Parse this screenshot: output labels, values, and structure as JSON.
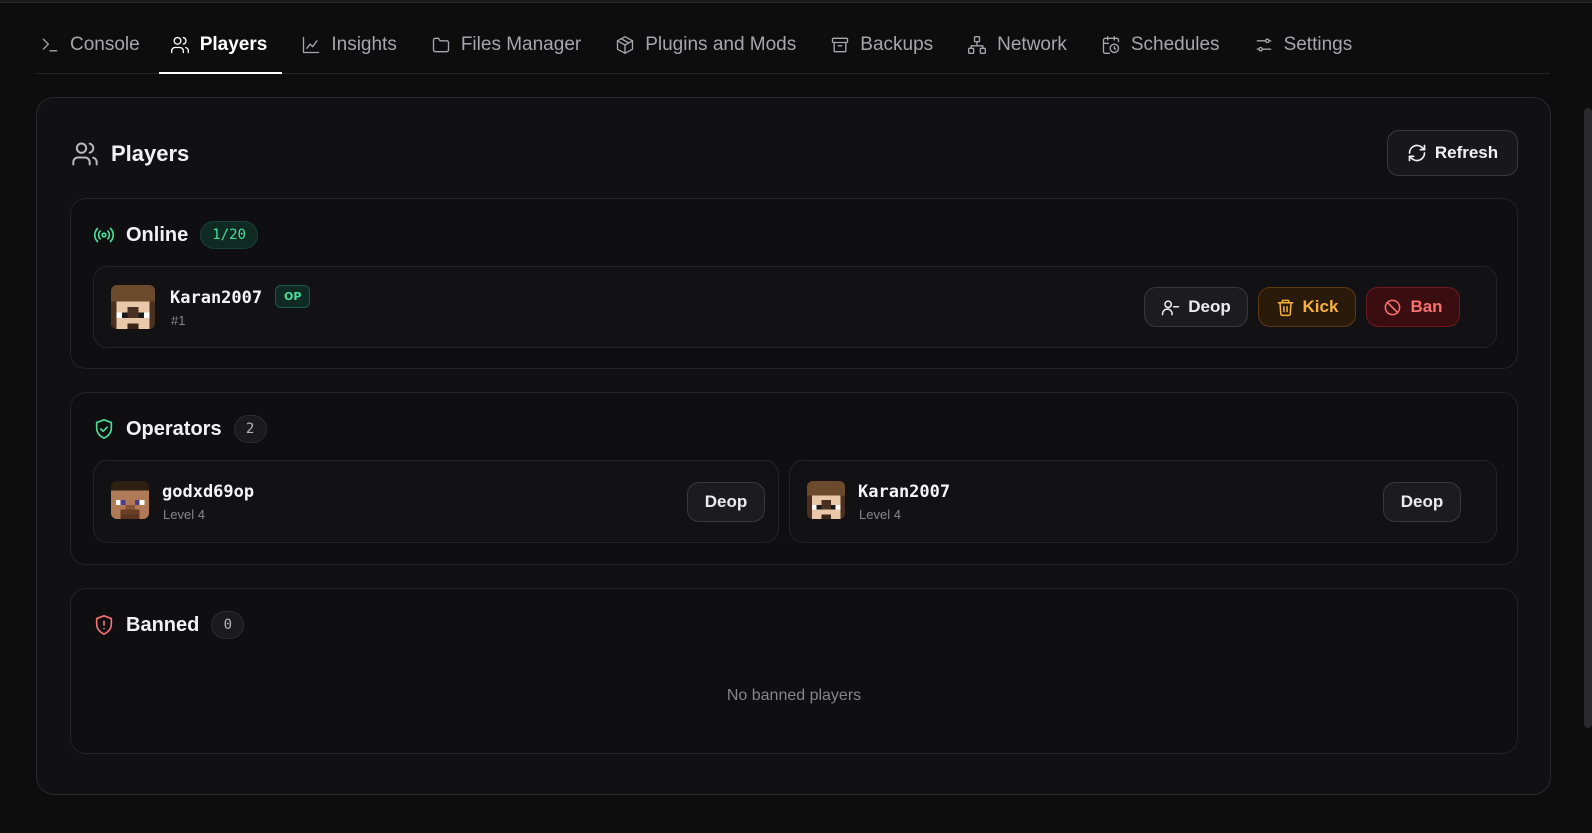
{
  "tabs": [
    {
      "label": "Console",
      "icon": "terminal-icon"
    },
    {
      "label": "Players",
      "icon": "users-icon",
      "active": true
    },
    {
      "label": "Insights",
      "icon": "chart-line-icon"
    },
    {
      "label": "Files Manager",
      "icon": "folder-icon"
    },
    {
      "label": "Plugins and Mods",
      "icon": "package-icon"
    },
    {
      "label": "Backups",
      "icon": "archive-icon"
    },
    {
      "label": "Network",
      "icon": "network-icon"
    },
    {
      "label": "Schedules",
      "icon": "calendar-clock-icon"
    },
    {
      "label": "Settings",
      "icon": "settings-sliders-icon"
    }
  ],
  "players_panel": {
    "title": "Players",
    "refresh_label": "Refresh"
  },
  "online": {
    "title": "Online",
    "count": "1/20",
    "players": [
      {
        "name": "Karan2007",
        "badge": "OP",
        "sub": "#1",
        "deop": "Deop",
        "kick": "Kick",
        "ban": "Ban"
      }
    ]
  },
  "operators": {
    "title": "Operators",
    "count": "2",
    "players": [
      {
        "name": "godxd69op",
        "sub": "Level 4",
        "deop": "Deop"
      },
      {
        "name": "Karan2007",
        "sub": "Level 4",
        "deop": "Deop"
      }
    ]
  },
  "banned": {
    "title": "Banned",
    "count": "0",
    "empty": "No banned players"
  },
  "colors": {
    "background": "#0d0d0e",
    "accent_green": "#4ade9b",
    "kick": "#f6b23b",
    "ban": "#f87171"
  }
}
